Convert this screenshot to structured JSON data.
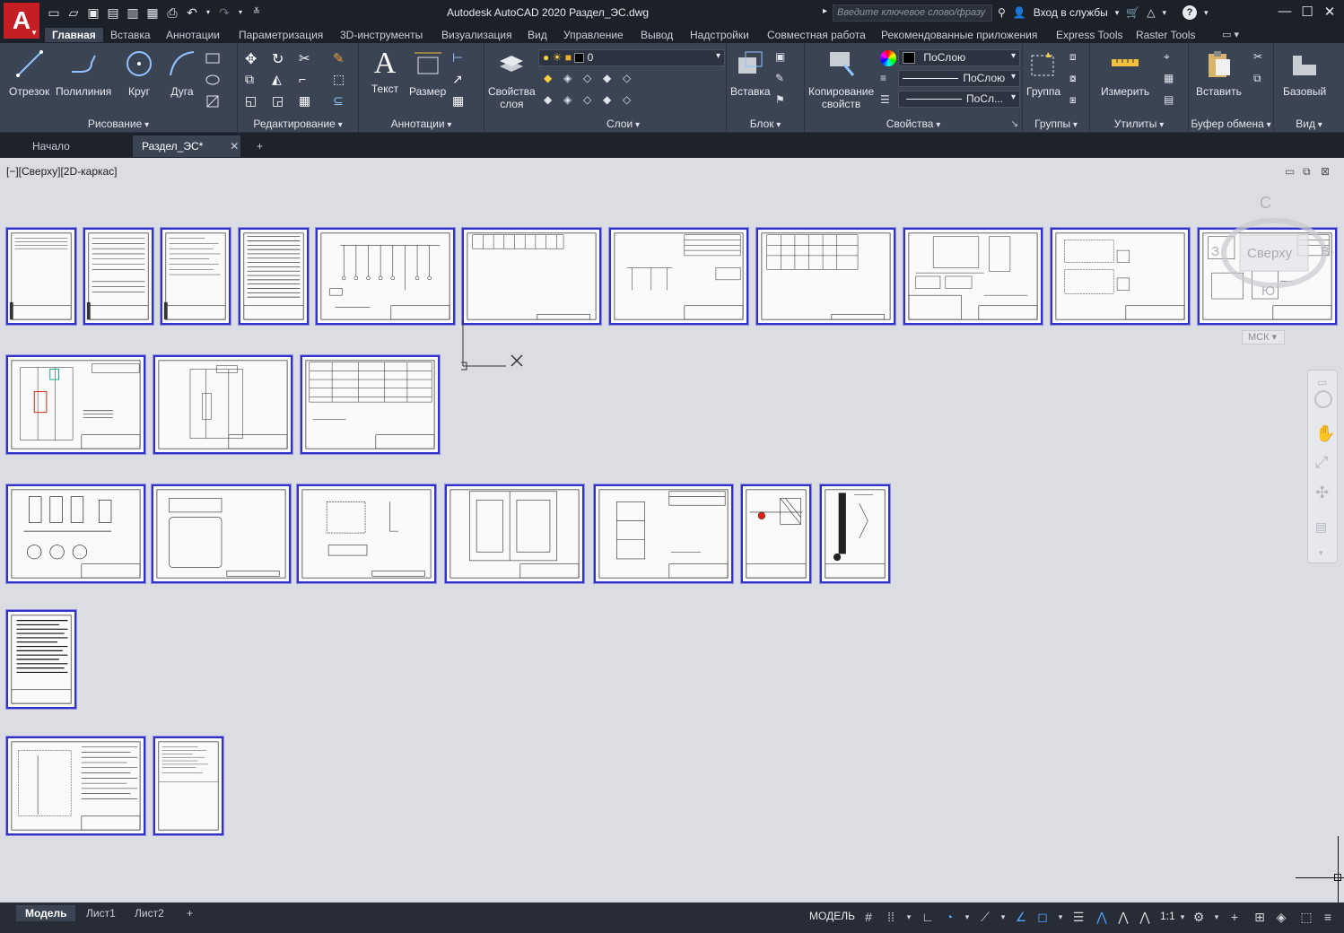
{
  "app": {
    "logo_letter": "A",
    "window_title": "Autodesk AutoCAD 2020    Раздел_ЭС.dwg",
    "search_placeholder": "Введите ключевое слово/фразу",
    "signin": "Вход в службы",
    "help": "?"
  },
  "ribbon_tabs": [
    "Главная",
    "Вставка",
    "Аннотации",
    "Параметризация",
    "3D-инструменты",
    "Визуализация",
    "Вид",
    "Управление",
    "Вывод",
    "Надстройки",
    "Совместная работа",
    "Рекомендованные приложения",
    "Express Tools",
    "Raster Tools"
  ],
  "panels": {
    "draw": {
      "label": "Рисование",
      "tools": [
        "Отрезок",
        "Полилиния",
        "Круг",
        "Дуга"
      ]
    },
    "modify": {
      "label": "Редактирование"
    },
    "annotation": {
      "label": "Аннотации",
      "tools": [
        "Текст",
        "Размер"
      ]
    },
    "layers": {
      "label": "Слои",
      "tool1": "Свойства",
      "tool2": "слоя",
      "current_layer": "0"
    },
    "block": {
      "label": "Блок",
      "tool": "Вставка"
    },
    "properties": {
      "label": "Свойства",
      "tool1": "Копирование",
      "tool2": "свойств",
      "color": "ПоСлою",
      "linetype": "ПоСлою",
      "lineweight": "ПоСл..."
    },
    "groups": {
      "label": "Группы",
      "tool": "Группа"
    },
    "utilities": {
      "label": "Утилиты",
      "tool": "Измерить"
    },
    "clipboard": {
      "label": "Буфер обмена",
      "tool": "Вставить"
    },
    "view": {
      "label": "Вид",
      "tool": "Базовый"
    }
  },
  "doc_tabs": {
    "start": "Начало",
    "active": "Раздел_ЭС*",
    "close": "✕",
    "add": "+"
  },
  "viewport": {
    "label": "[−][Сверху][2D-каркас]",
    "viewcube_face": "Сверху",
    "viewcube_north": "С",
    "viewcube_south": "Ю",
    "viewcube_west": "З",
    "viewcube_east": "В",
    "ucs_name": "МСК"
  },
  "layout_tabs": [
    "Модель",
    "Лист1",
    "Лист2"
  ],
  "status": {
    "model": "МОДЕЛЬ",
    "scale": "1:1"
  },
  "colors": {
    "accent": "#4fa2ff",
    "sheet_border": "#3232c8",
    "logo": "#c51f24",
    "ribbon": "#3b4453",
    "canvas": "#dcdde2"
  }
}
